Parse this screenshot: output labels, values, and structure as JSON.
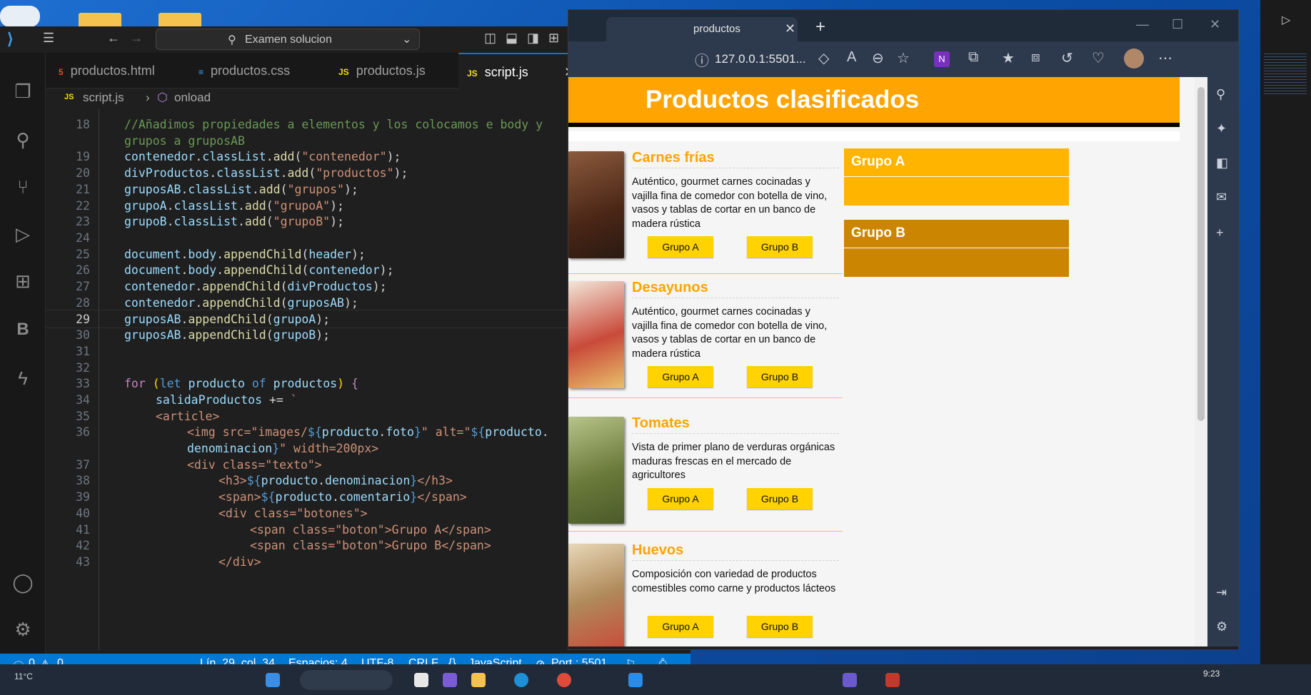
{
  "vscode": {
    "search_text": "Examen solucion",
    "tabs": [
      {
        "label": "productos.html",
        "type": "html"
      },
      {
        "label": "productos.css",
        "type": "css"
      },
      {
        "label": "productos.js",
        "type": "js"
      },
      {
        "label": "script.js",
        "type": "js"
      }
    ],
    "js_badge": "JS",
    "breadcrumb": {
      "file": "script.js",
      "symbol": "onload"
    },
    "current_line": 29,
    "code": [
      {
        "n": "18",
        "indent": 0,
        "tokens": [
          [
            "cmt",
            "//Añadimos propiedades a elementos y los colocamos e body y"
          ]
        ]
      },
      {
        "n": "",
        "indent": 0,
        "tokens": [
          [
            "cmt",
            "grupos a gruposAB"
          ]
        ]
      },
      {
        "n": "19",
        "indent": 0,
        "tokens": [
          [
            "var",
            "contenedor"
          ],
          [
            "punc",
            "."
          ],
          [
            "var",
            "classList"
          ],
          [
            "punc",
            "."
          ],
          [
            "fn",
            "add"
          ],
          [
            "punc",
            "("
          ],
          [
            "str",
            "\"contenedor\""
          ],
          [
            "punc",
            ");"
          ]
        ]
      },
      {
        "n": "20",
        "indent": 0,
        "tokens": [
          [
            "var",
            "divProductos"
          ],
          [
            "punc",
            "."
          ],
          [
            "var",
            "classList"
          ],
          [
            "punc",
            "."
          ],
          [
            "fn",
            "add"
          ],
          [
            "punc",
            "("
          ],
          [
            "str",
            "\"productos\""
          ],
          [
            "punc",
            ");"
          ]
        ]
      },
      {
        "n": "21",
        "indent": 0,
        "tokens": [
          [
            "var",
            "gruposAB"
          ],
          [
            "punc",
            "."
          ],
          [
            "var",
            "classList"
          ],
          [
            "punc",
            "."
          ],
          [
            "fn",
            "add"
          ],
          [
            "punc",
            "("
          ],
          [
            "str",
            "\"grupos\""
          ],
          [
            "punc",
            ");"
          ]
        ]
      },
      {
        "n": "22",
        "indent": 0,
        "tokens": [
          [
            "var",
            "grupoA"
          ],
          [
            "punc",
            "."
          ],
          [
            "var",
            "classList"
          ],
          [
            "punc",
            "."
          ],
          [
            "fn",
            "add"
          ],
          [
            "punc",
            "("
          ],
          [
            "str",
            "\"grupoA\""
          ],
          [
            "punc",
            ");"
          ]
        ]
      },
      {
        "n": "23",
        "indent": 0,
        "tokens": [
          [
            "var",
            "grupoB"
          ],
          [
            "punc",
            "."
          ],
          [
            "var",
            "classList"
          ],
          [
            "punc",
            "."
          ],
          [
            "fn",
            "add"
          ],
          [
            "punc",
            "("
          ],
          [
            "str",
            "\"grupoB\""
          ],
          [
            "punc",
            ");"
          ]
        ]
      },
      {
        "n": "24",
        "indent": 0,
        "tokens": []
      },
      {
        "n": "25",
        "indent": 0,
        "tokens": [
          [
            "var",
            "document"
          ],
          [
            "punc",
            "."
          ],
          [
            "var",
            "body"
          ],
          [
            "punc",
            "."
          ],
          [
            "fn",
            "appendChild"
          ],
          [
            "punc",
            "("
          ],
          [
            "var",
            "header"
          ],
          [
            "punc",
            ");"
          ]
        ]
      },
      {
        "n": "26",
        "indent": 0,
        "tokens": [
          [
            "var",
            "document"
          ],
          [
            "punc",
            "."
          ],
          [
            "var",
            "body"
          ],
          [
            "punc",
            "."
          ],
          [
            "fn",
            "appendChild"
          ],
          [
            "punc",
            "("
          ],
          [
            "var",
            "contenedor"
          ],
          [
            "punc",
            ");"
          ]
        ]
      },
      {
        "n": "27",
        "indent": 0,
        "tokens": [
          [
            "var",
            "contenedor"
          ],
          [
            "punc",
            "."
          ],
          [
            "fn",
            "appendChild"
          ],
          [
            "punc",
            "("
          ],
          [
            "var",
            "divProductos"
          ],
          [
            "punc",
            ");"
          ]
        ]
      },
      {
        "n": "28",
        "indent": 0,
        "tokens": [
          [
            "var",
            "contenedor"
          ],
          [
            "punc",
            "."
          ],
          [
            "fn",
            "appendChild"
          ],
          [
            "punc",
            "("
          ],
          [
            "var",
            "gruposAB"
          ],
          [
            "punc",
            ");"
          ]
        ]
      },
      {
        "n": "29",
        "indent": 0,
        "tokens": [
          [
            "var",
            "gruposAB"
          ],
          [
            "punc",
            "."
          ],
          [
            "fn",
            "appendChild"
          ],
          [
            "punc",
            "("
          ],
          [
            "var",
            "grupoA"
          ],
          [
            "punc",
            ");"
          ]
        ]
      },
      {
        "n": "30",
        "indent": 0,
        "tokens": [
          [
            "var",
            "gruposAB"
          ],
          [
            "punc",
            "."
          ],
          [
            "fn",
            "appendChild"
          ],
          [
            "punc",
            "("
          ],
          [
            "var",
            "grupoB"
          ],
          [
            "punc",
            ");"
          ]
        ]
      },
      {
        "n": "31",
        "indent": 0,
        "tokens": []
      },
      {
        "n": "32",
        "indent": 0,
        "tokens": []
      },
      {
        "n": "33",
        "indent": 0,
        "tokens": [
          [
            "kw",
            "for"
          ],
          [
            "punc",
            " "
          ],
          [
            "yel",
            "("
          ],
          [
            "tag",
            "let"
          ],
          [
            "punc",
            " "
          ],
          [
            "var",
            "producto"
          ],
          [
            "punc",
            " "
          ],
          [
            "tag",
            "of"
          ],
          [
            "punc",
            " "
          ],
          [
            "var",
            "productos"
          ],
          [
            "yel",
            ")"
          ],
          [
            "punc",
            " "
          ],
          [
            "kw",
            "{"
          ]
        ]
      },
      {
        "n": "34",
        "indent": 1,
        "tokens": [
          [
            "var",
            "salidaProductos"
          ],
          [
            "punc",
            " += "
          ],
          [
            "str",
            "`"
          ]
        ]
      },
      {
        "n": "35",
        "indent": 1,
        "tokens": [
          [
            "str",
            "<article>"
          ]
        ]
      },
      {
        "n": "36",
        "indent": 2,
        "tokens": [
          [
            "str",
            "<img src=\"images/"
          ],
          [
            "tag",
            "${"
          ],
          [
            "var",
            "producto"
          ],
          [
            "punc",
            "."
          ],
          [
            "var",
            "foto"
          ],
          [
            "tag",
            "}"
          ],
          [
            "str",
            "\" alt=\""
          ],
          [
            "tag",
            "${"
          ],
          [
            "var",
            "producto"
          ],
          [
            "punc",
            "."
          ]
        ]
      },
      {
        "n": "",
        "indent": 2,
        "tokens": [
          [
            "var",
            "denominacion"
          ],
          [
            "tag",
            "}"
          ],
          [
            "str",
            "\" width=200px>"
          ]
        ]
      },
      {
        "n": "37",
        "indent": 2,
        "tokens": [
          [
            "str",
            "<div class=\"texto\">"
          ]
        ]
      },
      {
        "n": "38",
        "indent": 3,
        "tokens": [
          [
            "str",
            "<h3>"
          ],
          [
            "tag",
            "${"
          ],
          [
            "var",
            "producto"
          ],
          [
            "punc",
            "."
          ],
          [
            "var",
            "denominacion"
          ],
          [
            "tag",
            "}"
          ],
          [
            "str",
            "</h3>"
          ]
        ]
      },
      {
        "n": "39",
        "indent": 3,
        "tokens": [
          [
            "str",
            "<span>"
          ],
          [
            "tag",
            "${"
          ],
          [
            "var",
            "producto"
          ],
          [
            "punc",
            "."
          ],
          [
            "var",
            "comentario"
          ],
          [
            "tag",
            "}"
          ],
          [
            "str",
            "</span>"
          ]
        ]
      },
      {
        "n": "40",
        "indent": 3,
        "tokens": [
          [
            "str",
            "<div class=\"botones\">"
          ]
        ]
      },
      {
        "n": "41",
        "indent": 4,
        "tokens": [
          [
            "str",
            "<span class=\"boton\">Grupo A</span>"
          ]
        ]
      },
      {
        "n": "42",
        "indent": 4,
        "tokens": [
          [
            "str",
            "<span class=\"boton\">Grupo B</span>"
          ]
        ]
      },
      {
        "n": "43",
        "indent": 3,
        "tokens": [
          [
            "str",
            "</div>"
          ]
        ]
      }
    ],
    "status": {
      "errors": "0",
      "warnings": "0",
      "position": "Lín. 29, col. 34",
      "spaces": "Espacios: 4",
      "encoding": "UTF-8",
      "eol": "CRLF",
      "language": "JavaScript",
      "port": "Port : 5501"
    }
  },
  "browser": {
    "tab_title": "productos",
    "url": "127.0.0.1:5501...",
    "page": {
      "title": "Productos clasificados",
      "products": [
        {
          "name": "Carnes frías",
          "desc": "Auténtico, gourmet carnes cocinadas y vajilla fina de comedor con botella de vino, vasos y tablas de cortar en un banco de madera rústica",
          "img_color": "#6b3a24"
        },
        {
          "name": "Desayunos",
          "desc": "Auténtico, gourmet carnes cocinadas y vajilla fina de comedor con botella de vino, vasos y tablas de cortar en un banco de madera rústica",
          "img_color": "#c94a3a"
        },
        {
          "name": "Tomates",
          "desc": "Vista de primer plano de verduras orgánicas maduras frescas en el mercado de agricultores",
          "img_color": "#7a8a4a"
        },
        {
          "name": "Huevos",
          "desc": "Composición con variedad de productos comestibles como carne y productos lácteos",
          "img_color": "#b08a5a"
        }
      ],
      "button_a": "Grupo A",
      "button_b": "Grupo B",
      "groups": [
        {
          "title": "Grupo A",
          "color": "#ffb400"
        },
        {
          "title": "Grupo B",
          "color": "#cc8500"
        }
      ]
    }
  },
  "taskbar": {
    "weather": "11°C",
    "clock": "9:23"
  },
  "colors": {
    "vscode_accent": "#0078d4",
    "header_orange": "#ffa400",
    "button_yellow": "#ffd200"
  }
}
